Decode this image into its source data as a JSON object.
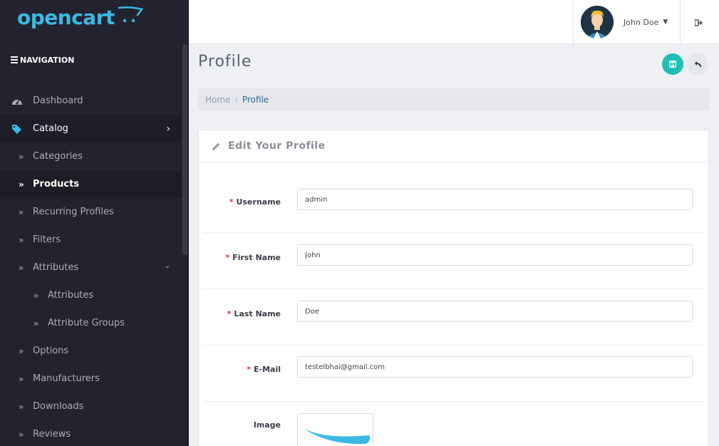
{
  "brand": {
    "logo_text": "opencart",
    "accent": "#3bb9e3"
  },
  "sidebar": {
    "heading": "NAVIGATION",
    "items": [
      {
        "label": "Dashboard",
        "icon": "dashboard-icon"
      },
      {
        "label": "Catalog",
        "icon": "tags-icon"
      },
      {
        "label": "Categories"
      },
      {
        "label": "Products"
      },
      {
        "label": "Recurring Profiles"
      },
      {
        "label": "Filters"
      },
      {
        "label": "Attributes"
      },
      {
        "label": "Attributes"
      },
      {
        "label": "Attribute Groups"
      },
      {
        "label": "Options"
      },
      {
        "label": "Manufacturers"
      },
      {
        "label": "Downloads"
      },
      {
        "label": "Reviews"
      }
    ]
  },
  "header": {
    "user_name": "John Doe"
  },
  "page": {
    "title": "Profile",
    "breadcrumb": {
      "home": "Home",
      "separator": "›",
      "current": "Profile"
    }
  },
  "panel": {
    "title": "Edit Your Profile",
    "fields": {
      "username": {
        "label": "Username",
        "value": "admin"
      },
      "first_name": {
        "label": "First Name",
        "value": "John"
      },
      "last_name": {
        "label": "Last Name",
        "value": "Doe"
      },
      "email": {
        "label": "E-Mail",
        "value": "testelbhai@gmail.com"
      },
      "image": {
        "label": "Image"
      }
    },
    "required_marker": "*"
  },
  "colors": {
    "save_button": "#1fbfb3",
    "sidebar_bg": "#23232f",
    "link": "#2f6f95"
  }
}
